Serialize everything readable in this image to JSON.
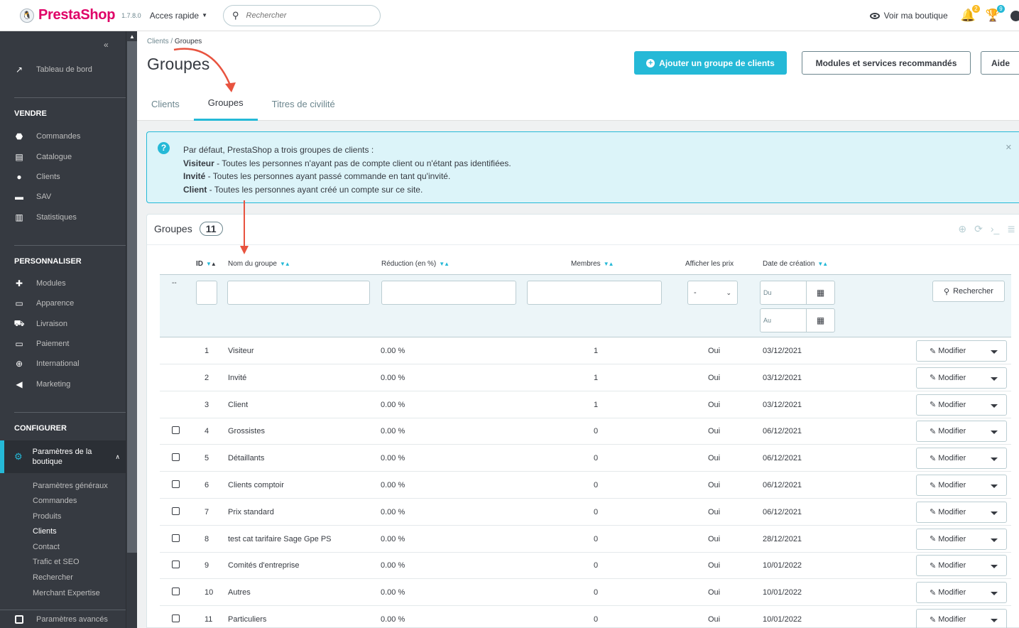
{
  "topbar": {
    "logo": "PrestaShop",
    "version": "1.7.8.0",
    "quick_access": "Acces rapide",
    "search_placeholder": "Rechercher",
    "view_shop": "Voir ma boutique",
    "notif_badge_1": "2",
    "notif_badge_2": "9"
  },
  "sidebar": {
    "dashboard": "Tableau de bord",
    "sections": {
      "vendre": "VENDRE",
      "personnaliser": "PERSONNALISER",
      "configurer": "CONFIGURER"
    },
    "vendre_items": [
      "Commandes",
      "Catalogue",
      "Clients",
      "SAV",
      "Statistiques"
    ],
    "personnaliser_items": [
      "Modules",
      "Apparence",
      "Livraison",
      "Paiement",
      "International",
      "Marketing"
    ],
    "active_item": "Paramètres de la boutique",
    "sub_items": [
      "Paramètres généraux",
      "Commandes",
      "Produits",
      "Clients",
      "Contact",
      "Trafic et SEO",
      "Rechercher",
      "Merchant Expertise"
    ],
    "advanced": "Paramètres avancés"
  },
  "header": {
    "breadcrumb_parent": "Clients",
    "breadcrumb_sep": "/",
    "breadcrumb_current": "Groupes",
    "title": "Groupes",
    "add_button": "Ajouter un groupe de clients",
    "modules_button": "Modules et services recommandés",
    "help_button": "Aide",
    "tabs": [
      "Clients",
      "Groupes",
      "Titres de civilité"
    ]
  },
  "alert": {
    "intro": "Par défaut, PrestaShop a trois groupes de clients :",
    "line1_bold": "Visiteur",
    "line1_text": " - Toutes les personnes n'ayant pas de compte client ou n'étant pas identifiées.",
    "line2_bold": "Invité",
    "line2_text": " - Toutes les personnes ayant passé commande en tant qu'invité.",
    "line3_bold": "Client",
    "line3_text": " - Toutes les personnes ayant créé un compte sur ce site."
  },
  "panel": {
    "title": "Groupes",
    "count": "11",
    "columns": {
      "id": "ID",
      "name": "Nom du groupe",
      "reduction": "Réduction (en %)",
      "members": "Membres",
      "show_prices": "Afficher les prix",
      "date": "Date de création"
    },
    "filters": {
      "bulk": "--",
      "select_value": "-",
      "date_from": "Du",
      "date_to": "Au",
      "search_button": "Rechercher"
    },
    "edit_label": "Modifier",
    "rows": [
      {
        "id": "1",
        "name": "Visiteur",
        "reduction": "0.00 %",
        "members": "1",
        "prices": "Oui",
        "date": "03/12/2021",
        "checkbox": false
      },
      {
        "id": "2",
        "name": "Invité",
        "reduction": "0.00 %",
        "members": "1",
        "prices": "Oui",
        "date": "03/12/2021",
        "checkbox": false
      },
      {
        "id": "3",
        "name": "Client",
        "reduction": "0.00 %",
        "members": "1",
        "prices": "Oui",
        "date": "03/12/2021",
        "checkbox": false
      },
      {
        "id": "4",
        "name": "Grossistes",
        "reduction": "0.00 %",
        "members": "0",
        "prices": "Oui",
        "date": "06/12/2021",
        "checkbox": true
      },
      {
        "id": "5",
        "name": "Détaillants",
        "reduction": "0.00 %",
        "members": "0",
        "prices": "Oui",
        "date": "06/12/2021",
        "checkbox": true
      },
      {
        "id": "6",
        "name": "Clients comptoir",
        "reduction": "0.00 %",
        "members": "0",
        "prices": "Oui",
        "date": "06/12/2021",
        "checkbox": true
      },
      {
        "id": "7",
        "name": "Prix standard",
        "reduction": "0.00 %",
        "members": "0",
        "prices": "Oui",
        "date": "06/12/2021",
        "checkbox": true
      },
      {
        "id": "8",
        "name": "test cat tarifaire Sage Gpe PS",
        "reduction": "0.00 %",
        "members": "0",
        "prices": "Oui",
        "date": "28/12/2021",
        "checkbox": true
      },
      {
        "id": "9",
        "name": "Comités d'entreprise",
        "reduction": "0.00 %",
        "members": "0",
        "prices": "Oui",
        "date": "10/01/2022",
        "checkbox": true
      },
      {
        "id": "10",
        "name": "Autres",
        "reduction": "0.00 %",
        "members": "0",
        "prices": "Oui",
        "date": "10/01/2022",
        "checkbox": true
      },
      {
        "id": "11",
        "name": "Particuliers",
        "reduction": "0.00 %",
        "members": "0",
        "prices": "Oui",
        "date": "10/01/2022",
        "checkbox": true
      }
    ]
  },
  "colors": {
    "accent": "#25b9d7",
    "brand": "#df0067",
    "sidebar": "#363a41",
    "annotation": "#e8533f"
  }
}
